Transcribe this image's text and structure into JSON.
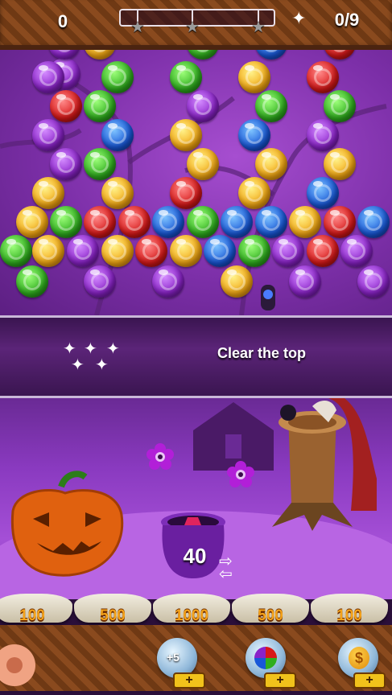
{
  "hud": {
    "score": "0",
    "goal_progress": "0/9",
    "stars_earned": 0,
    "stars_total": 3
  },
  "banner": {
    "text": "Clear the top"
  },
  "pot": {
    "count": "40"
  },
  "pots": [
    "100",
    "500",
    "1000",
    "500",
    "100"
  ],
  "boosters": [
    {
      "name": "plus5-booster",
      "label": "+5",
      "icon": "plus-five-icon"
    },
    {
      "name": "rainbow-booster",
      "label": "",
      "icon": "rainbow-ball-icon"
    },
    {
      "name": "coin-booster",
      "label": "",
      "icon": "coin-icon"
    }
  ],
  "colors": {
    "purple": "#8a22c9",
    "green": "#2fae1e",
    "red": "#d81818",
    "blue": "#1857d8",
    "yellow": "#f3a712"
  }
}
